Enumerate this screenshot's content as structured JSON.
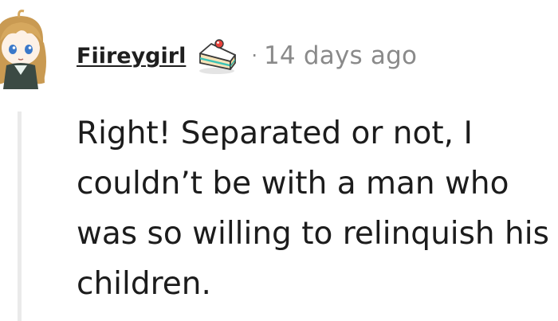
{
  "comment": {
    "username": "Fiireygirl",
    "separator": "·",
    "timestamp": "14 days ago",
    "text": "Right! Separated or not, I couldn’t be with a man who was so willing to relinquish his children."
  },
  "icons": {
    "avatar": "anime-girl-avatar",
    "badge": "cake-slice-badge-icon"
  },
  "colors": {
    "username": "#1f1f1f",
    "timestamp": "#8a8a8a",
    "thread_line": "#eaeaea",
    "body_text": "#1c1c1c"
  }
}
